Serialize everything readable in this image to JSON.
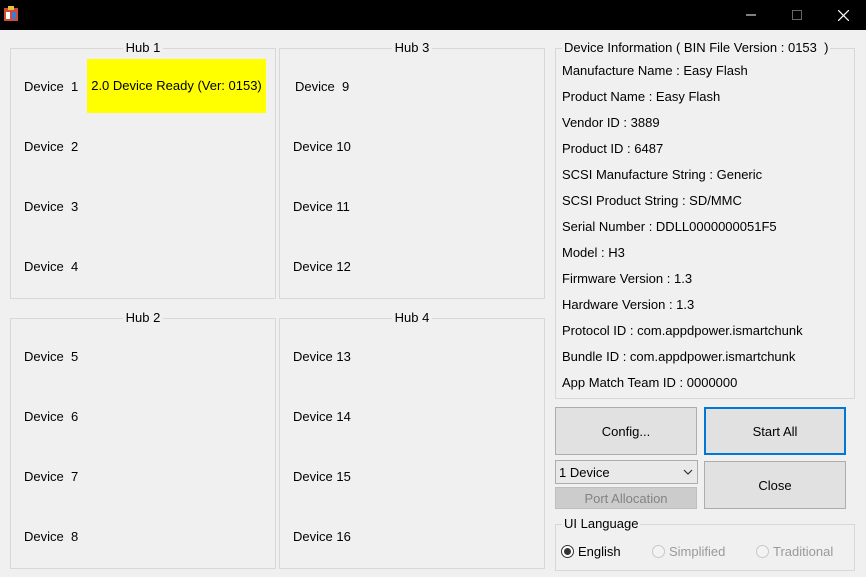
{
  "window": {
    "icon": "app-icon",
    "controls": {
      "minimize": "—",
      "maximize": "☐",
      "close": "✕"
    }
  },
  "hubs": [
    {
      "title": "Hub 1",
      "devices": [
        "Device  1",
        "Device  2",
        "Device  3",
        "Device  4"
      ]
    },
    {
      "title": "Hub 3",
      "devices": [
        "Device  9",
        "Device 10",
        "Device 11",
        "Device 12"
      ]
    },
    {
      "title": "Hub 2",
      "devices": [
        "Device  5",
        "Device  6",
        "Device  7",
        "Device  8"
      ]
    },
    {
      "title": "Hub 4",
      "devices": [
        "Device 13",
        "Device 14",
        "Device 15",
        "Device 16"
      ]
    }
  ],
  "device1_status": {
    "text": "2.0 Device Ready (Ver: 0153)",
    "color": "#ffff00"
  },
  "device_info": {
    "title": "Device Information ( BIN File Version : 0153  )",
    "lines": [
      "Manufacture Name : Easy Flash",
      "Product Name : Easy Flash",
      "Vendor ID : 3889",
      "Product ID : 6487",
      "SCSI Manufacture String : Generic",
      "SCSI Product String : SD/MMC",
      "Serial Number : DDLL0000000051F5",
      "Model : H3",
      "Firmware Version : 1.3",
      "Hardware Version : 1.3",
      "Protocol ID : com.appdpower.ismartchunk",
      "Bundle ID : com.appdpower.ismartchunk",
      "App Match Team ID : 0000000"
    ]
  },
  "buttons": {
    "config": "Config...",
    "start_all": "Start All",
    "close": "Close",
    "port_allocation": "Port Allocation"
  },
  "device_count_select": {
    "value": "1 Device"
  },
  "ui_language": {
    "title": "UI Language",
    "options": [
      {
        "label": "English",
        "selected": true,
        "enabled": true
      },
      {
        "label": "Simplified",
        "selected": false,
        "enabled": false
      },
      {
        "label": "Traditional",
        "selected": false,
        "enabled": false
      }
    ]
  },
  "colors": {
    "accent": "#0078d7",
    "highlight": "#ffff00"
  }
}
